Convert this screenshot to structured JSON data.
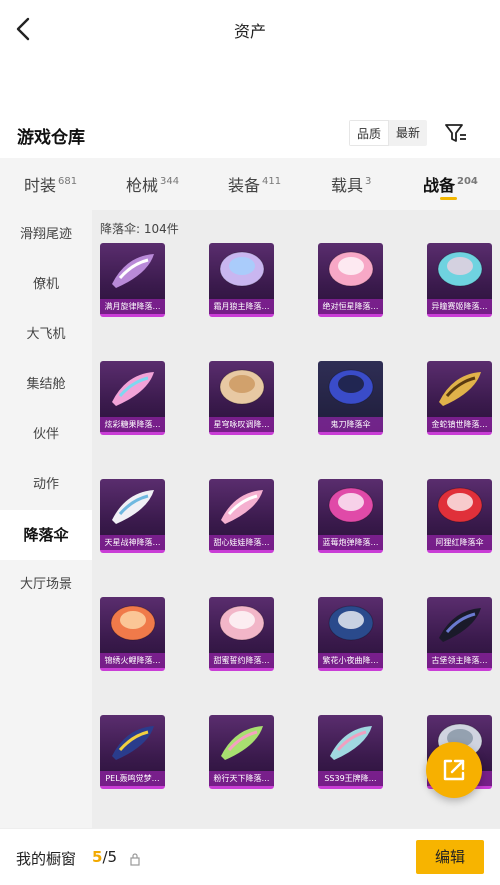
{
  "header": {
    "title": "资产",
    "back_icon": "back-arrow-icon"
  },
  "warehouse": {
    "title": "游戏仓库",
    "sort_options": [
      "品质",
      "最新"
    ],
    "sort_selected": "品质",
    "filter_icon": "filter-icon"
  },
  "categories": [
    {
      "label": "时装",
      "count": "681"
    },
    {
      "label": "枪械",
      "count": "344"
    },
    {
      "label": "装备",
      "count": "411"
    },
    {
      "label": "载具",
      "count": "3"
    },
    {
      "label": "战备",
      "count": "204"
    }
  ],
  "active_category": "战备",
  "sidebar": {
    "items": [
      "滑翔尾迹",
      "僚机",
      "大飞机",
      "集结舱",
      "伙伴",
      "动作",
      "降落伞",
      "大厅场景"
    ],
    "active": "降落伞"
  },
  "content": {
    "count_label": "降落伞: 104件",
    "items": [
      {
        "name": "满月旋律降落…",
        "art": "purple-wing"
      },
      {
        "name": "霜月狼主降落…",
        "art": "lavender-fur"
      },
      {
        "name": "绝对恒星降落…",
        "art": "pink-dome"
      },
      {
        "name": "异瞳赛姬降落…",
        "art": "teal-dome"
      },
      {
        "name": "炫彩糖果降落…",
        "art": "rainbow-wing"
      },
      {
        "name": "星穹咏叹调降…",
        "art": "tan-dome"
      },
      {
        "name": "鬼刀降落伞",
        "art": "blue-dark-dome"
      },
      {
        "name": "金蛇镇世降落…",
        "art": "gold-wing"
      },
      {
        "name": "天星战神降落…",
        "art": "white-wing"
      },
      {
        "name": "甜心娃娃降落…",
        "art": "pink-wing"
      },
      {
        "name": "蓝莓炮弹降落…",
        "art": "magenta-dome"
      },
      {
        "name": "阿狸红降落伞",
        "art": "red-ahri"
      },
      {
        "name": "锦绣火鲤降落…",
        "art": "orange-dome"
      },
      {
        "name": "甜蜜誓约降落…",
        "art": "blush-dome"
      },
      {
        "name": "繁花小夜曲降…",
        "art": "navy-dome"
      },
      {
        "name": "古堡领主降落…",
        "art": "black-wing"
      },
      {
        "name": "PEL轰鸣觉梦…",
        "art": "navy-wing"
      },
      {
        "name": "粉行天下降落…",
        "art": "green-wing"
      },
      {
        "name": "SS39王牌降…",
        "art": "teal-wing"
      },
      {
        "name": "",
        "art": "silver-dome"
      }
    ]
  },
  "bottom": {
    "showcase_label": "我的橱窗",
    "showcase_current": "5",
    "showcase_total": "/5",
    "edit_label": "编辑"
  },
  "colors": {
    "accent": "#f7b400",
    "card_bg": "#4a2560",
    "rarity": "#c93dd6"
  },
  "fab_icon": "share-icon"
}
